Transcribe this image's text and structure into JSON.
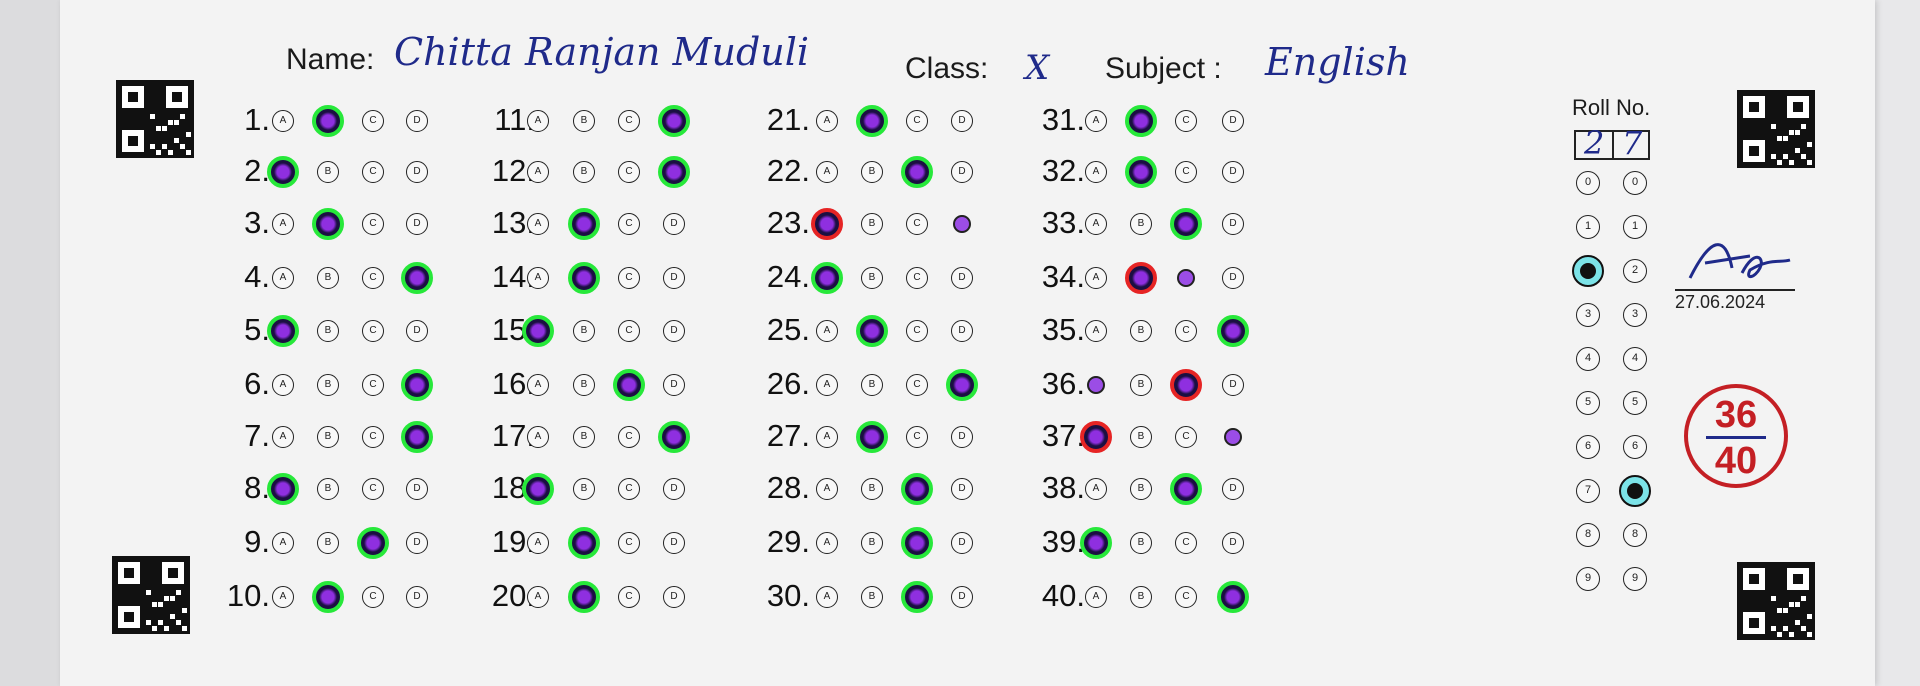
{
  "header": {
    "name_label": "Name:",
    "name_value": "Chitta Ranjan Muduli",
    "class_label": "Class:",
    "class_value": "X",
    "subject_label": "Subject :",
    "subject_value": "English"
  },
  "roll": {
    "label": "Roll No.",
    "digit1": "2",
    "digit2": "7",
    "digits": [
      "0",
      "1",
      "2",
      "3",
      "4",
      "5",
      "6",
      "7",
      "8",
      "9"
    ]
  },
  "signature": {
    "mark": "AS",
    "date": "27.06.2024"
  },
  "score": {
    "obtained": "36",
    "total": "40"
  },
  "colors": {
    "correct": "#27e83a",
    "wrong": "#e62424",
    "fill": "#8f2fe0",
    "score": "#c41f24",
    "handwriting": "#1f2a8a"
  },
  "options": [
    "A",
    "B",
    "C",
    "D"
  ],
  "questions": [
    {
      "n": "1.",
      "marked": "B",
      "status": "correct"
    },
    {
      "n": "2.",
      "marked": "A",
      "status": "correct"
    },
    {
      "n": "3.",
      "marked": "B",
      "status": "correct"
    },
    {
      "n": "4.",
      "marked": "D",
      "status": "correct"
    },
    {
      "n": "5.",
      "marked": "A",
      "status": "correct"
    },
    {
      "n": "6.",
      "marked": "D",
      "status": "correct"
    },
    {
      "n": "7.",
      "marked": "D",
      "status": "correct"
    },
    {
      "n": "8.",
      "marked": "A",
      "status": "correct"
    },
    {
      "n": "9.",
      "marked": "C",
      "status": "correct"
    },
    {
      "n": "10.",
      "marked": "B",
      "status": "correct"
    },
    {
      "n": "11.",
      "marked": "D",
      "status": "correct"
    },
    {
      "n": "12.",
      "marked": "D",
      "status": "correct"
    },
    {
      "n": "13.",
      "marked": "B",
      "status": "correct"
    },
    {
      "n": "14.",
      "marked": "B",
      "status": "correct"
    },
    {
      "n": "15.",
      "marked": "A",
      "status": "correct"
    },
    {
      "n": "16.",
      "marked": "C",
      "status": "correct"
    },
    {
      "n": "17.",
      "marked": "D",
      "status": "correct"
    },
    {
      "n": "18.",
      "marked": "A",
      "status": "correct"
    },
    {
      "n": "19.",
      "marked": "B",
      "status": "correct"
    },
    {
      "n": "20.",
      "marked": "B",
      "status": "correct"
    },
    {
      "n": "21.",
      "marked": "B",
      "status": "correct"
    },
    {
      "n": "22.",
      "marked": "C",
      "status": "correct"
    },
    {
      "n": "23.",
      "marked": "A",
      "status": "wrong",
      "key": "D"
    },
    {
      "n": "24.",
      "marked": "A",
      "status": "correct"
    },
    {
      "n": "25.",
      "marked": "B",
      "status": "correct"
    },
    {
      "n": "26.",
      "marked": "D",
      "status": "correct"
    },
    {
      "n": "27.",
      "marked": "B",
      "status": "correct"
    },
    {
      "n": "28.",
      "marked": "C",
      "status": "correct"
    },
    {
      "n": "29.",
      "marked": "C",
      "status": "correct"
    },
    {
      "n": "30.",
      "marked": "C",
      "status": "correct"
    },
    {
      "n": "31.",
      "marked": "B",
      "status": "correct"
    },
    {
      "n": "32.",
      "marked": "B",
      "status": "correct"
    },
    {
      "n": "33.",
      "marked": "C",
      "status": "correct"
    },
    {
      "n": "34.",
      "marked": "B",
      "status": "wrong",
      "key": "C"
    },
    {
      "n": "35.",
      "marked": "D",
      "status": "correct"
    },
    {
      "n": "36.",
      "marked": "C",
      "status": "wrong",
      "key": "A"
    },
    {
      "n": "37.",
      "marked": "A",
      "status": "wrong",
      "key": "D"
    },
    {
      "n": "38.",
      "marked": "C",
      "status": "correct"
    },
    {
      "n": "39.",
      "marked": "A",
      "status": "correct"
    },
    {
      "n": "40.",
      "marked": "D",
      "status": "correct"
    }
  ]
}
